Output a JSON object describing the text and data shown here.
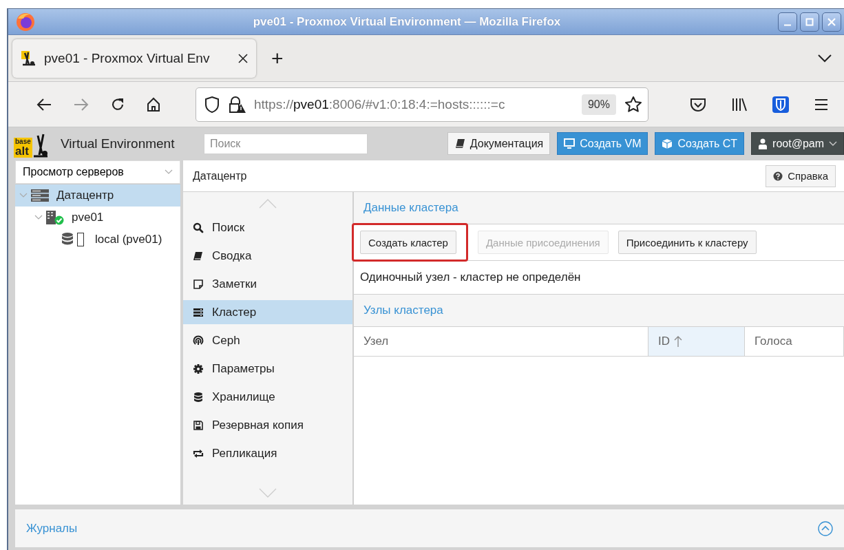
{
  "window": {
    "title": "pve01 - Proxmox Virtual Environment — Mozilla Firefox"
  },
  "browser": {
    "tabs": [
      {
        "title": "pve01 - Proxmox Virtual Env",
        "selected": true
      }
    ],
    "new_tab": "+",
    "nav": {
      "back_disabled": false,
      "forward_disabled": true
    },
    "url": {
      "scheme": "https://",
      "host": "pve01",
      "rest": ":8006/#v1:0:18:4:=hosts::::::=c"
    },
    "zoom": "90%"
  },
  "header": {
    "logo": {
      "top": "base",
      "bottom": "alt"
    },
    "product": "Virtual Environment",
    "search": {
      "placeholder": "Поиск"
    },
    "buttons": [
      {
        "label": "Документация",
        "kind": "docs"
      },
      {
        "label": "Создать VM",
        "kind": "vm"
      },
      {
        "label": "Создать CT",
        "kind": "ct"
      }
    ],
    "user": "root@pam"
  },
  "view_selector": "Просмотр серверов",
  "tree": [
    {
      "label": "Датацентр",
      "kind": "datacenter",
      "selected": true,
      "expanded": true,
      "children": [
        {
          "label": "pve01",
          "kind": "node",
          "selected": false,
          "expanded": true,
          "children": [
            {
              "label": "local (pve01)",
              "kind": "storage",
              "selected": false
            }
          ]
        }
      ]
    }
  ],
  "panel": {
    "title": "Датацентр",
    "help": "Справка"
  },
  "menu": [
    {
      "label": "Поиск",
      "kind": "search",
      "selected": false
    },
    {
      "label": "Сводка",
      "kind": "book",
      "selected": false
    },
    {
      "label": "Заметки",
      "kind": "note",
      "selected": false
    },
    {
      "label": "Кластер",
      "kind": "cluster",
      "selected": true
    },
    {
      "label": "Ceph",
      "kind": "ceph",
      "selected": false
    },
    {
      "label": "Параметры",
      "kind": "gear",
      "selected": false
    },
    {
      "label": "Хранилище",
      "kind": "database",
      "selected": false
    },
    {
      "label": "Резервная копия",
      "kind": "floppy",
      "selected": false
    },
    {
      "label": "Репликация",
      "kind": "replication",
      "selected": false
    }
  ],
  "cluster": {
    "title": "Данные кластера",
    "buttons": [
      {
        "label": "Создать кластер",
        "disabled": false,
        "highlighted": true
      },
      {
        "label": "Данные присоединения",
        "disabled": true,
        "highlighted": false
      },
      {
        "label": "Присоединить к кластеру",
        "disabled": false,
        "highlighted": false
      }
    ],
    "message": "Одиночный узел - кластер не определён"
  },
  "nodes": {
    "title": "Узлы кластера",
    "columns": [
      {
        "label": "Узел",
        "sorted": false
      },
      {
        "label": "ID",
        "sorted": true
      },
      {
        "label": "Голоса",
        "sorted": false
      }
    ]
  },
  "log_panel": {
    "title": "Журналы",
    "collapsed": true
  }
}
